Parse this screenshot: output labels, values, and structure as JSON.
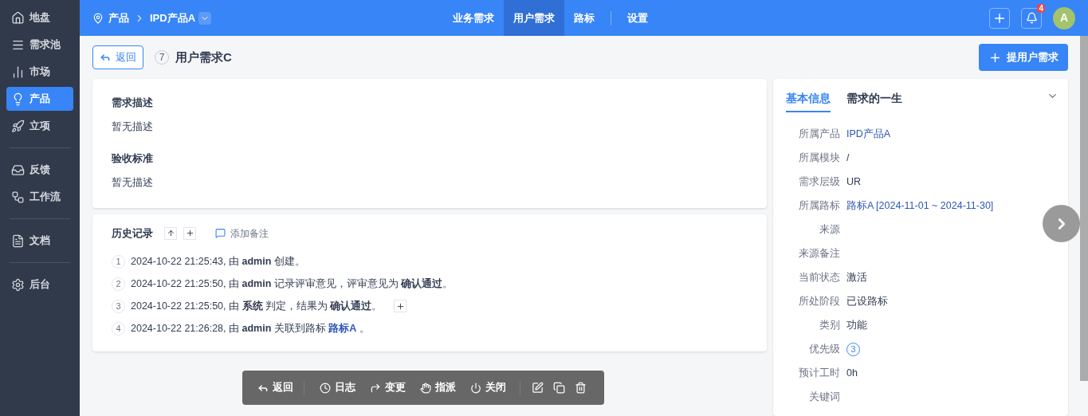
{
  "sidebar": {
    "groups": [
      [
        {
          "label": "地盘",
          "selected": false
        },
        {
          "label": "需求池",
          "selected": false
        },
        {
          "label": "市场",
          "selected": false
        },
        {
          "label": "产品",
          "selected": true
        },
        {
          "label": "立项",
          "selected": false
        }
      ],
      [
        {
          "label": "反馈",
          "selected": false
        },
        {
          "label": "工作流",
          "selected": false
        }
      ],
      [
        {
          "label": "文档",
          "selected": false
        }
      ],
      [
        {
          "label": "后台",
          "selected": false
        }
      ]
    ]
  },
  "topbar": {
    "breadcrumb": {
      "section": "产品",
      "product": "IPD产品A"
    },
    "tabs": [
      {
        "label": "业务需求",
        "selected": false
      },
      {
        "label": "用户需求",
        "selected": true
      },
      {
        "label": "路标",
        "selected": false
      },
      {
        "label": "设置",
        "selected": false
      }
    ],
    "notification_count": "4",
    "avatar": "A"
  },
  "header": {
    "back": "返回",
    "id": "7",
    "title": "用户需求C",
    "create_button": "提用户需求"
  },
  "description": {
    "sections": [
      {
        "heading": "需求描述",
        "body": "暂无描述"
      },
      {
        "heading": "验收标准",
        "body": "暂无描述"
      }
    ]
  },
  "history": {
    "title": "历史记录",
    "add_note": "添加备注",
    "entries": [
      {
        "index": "1",
        "has_plus": false,
        "parts": [
          {
            "kind": "plain",
            "text": "2024-10-22 21:25:43, 由 "
          },
          {
            "kind": "bold",
            "text": "admin"
          },
          {
            "kind": "plain",
            "text": " 创建。"
          }
        ]
      },
      {
        "index": "2",
        "has_plus": false,
        "parts": [
          {
            "kind": "plain",
            "text": "2024-10-22 21:25:50, 由 "
          },
          {
            "kind": "bold",
            "text": "admin"
          },
          {
            "kind": "plain",
            "text": " 记录评审意见，评审意见为 "
          },
          {
            "kind": "bold",
            "text": "确认通过"
          },
          {
            "kind": "plain",
            "text": "。"
          }
        ]
      },
      {
        "index": "3",
        "has_plus": true,
        "parts": [
          {
            "kind": "plain",
            "text": "2024-10-22 21:25:50, 由 "
          },
          {
            "kind": "bold",
            "text": "系统"
          },
          {
            "kind": "plain",
            "text": " 判定，结果为 "
          },
          {
            "kind": "bold",
            "text": "确认通过"
          },
          {
            "kind": "plain",
            "text": "。"
          }
        ]
      },
      {
        "index": "4",
        "has_plus": false,
        "parts": [
          {
            "kind": "plain",
            "text": "2024-10-22 21:26:28, 由 "
          },
          {
            "kind": "bold",
            "text": "admin"
          },
          {
            "kind": "plain",
            "text": " 关联到路标 "
          },
          {
            "kind": "link",
            "text": "路标A"
          },
          {
            "kind": "plain",
            "text": " 。"
          }
        ]
      }
    ]
  },
  "toolbar": {
    "back": "返回",
    "actions": [
      "日志",
      "变更",
      "指派",
      "关闭"
    ]
  },
  "info_panel": {
    "tabs": [
      {
        "label": "基本信息",
        "selected": true
      },
      {
        "label": "需求的一生",
        "selected": false
      }
    ],
    "fields": [
      {
        "label": "所属产品",
        "value": "IPD产品A",
        "kind": "link"
      },
      {
        "label": "所属模块",
        "value": "/",
        "kind": "text"
      },
      {
        "label": "需求层级",
        "value": "UR",
        "kind": "text"
      },
      {
        "label": "所属路标",
        "value": "路标A [2024-11-01 ~ 2024-11-30]",
        "kind": "link"
      },
      {
        "label": "来源"
      },
      {
        "label": "来源备注"
      },
      {
        "label": "当前状态",
        "value": "激活",
        "kind": "text"
      },
      {
        "label": "所处阶段",
        "value": "已设路标",
        "kind": "text"
      },
      {
        "label": "类别",
        "value": "功能",
        "kind": "text"
      },
      {
        "label": "优先级",
        "value": "3",
        "kind": "priority"
      },
      {
        "label": "预计工时",
        "value": "0h",
        "kind": "text"
      },
      {
        "label": "关键词"
      }
    ]
  }
}
